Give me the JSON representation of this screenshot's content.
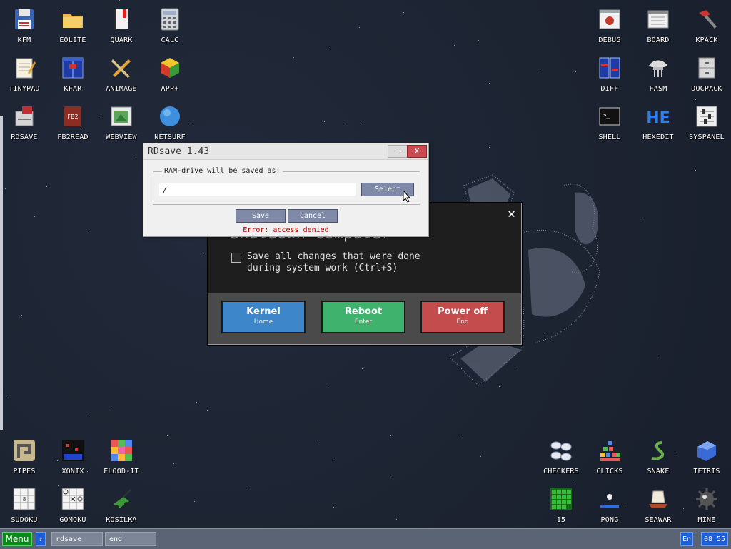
{
  "desktop_icons": {
    "kfm": "KFM",
    "eolite": "EOLITE",
    "quark": "QUARK",
    "calc": "CALC",
    "tinypad": "TINYPAD",
    "kfar": "KFAR",
    "animage": "ANIMAGE",
    "app_plus": "APP+",
    "rdsave": "RDSAVE",
    "fb2read": "FB2READ",
    "webview": "WEBVIEW",
    "netsurf": "NETSURF",
    "debug": "DEBUG",
    "board": "BOARD",
    "kpack": "KPACK",
    "diff": "DIFF",
    "fasm": "FASM",
    "docpack": "DOCPACK",
    "shell": "SHELL",
    "hexedit": "HEXEDIT",
    "syspanel": "SYSPANEL",
    "pipes": "PIPES",
    "xonix": "XONIX",
    "flood_it": "FLOOD-IT",
    "sudoku": "SUDOKU",
    "gomoku": "GOMOKU",
    "kosilka": "KOSILKA",
    "checkers": "CHECKERS",
    "clicks": "CLICKS",
    "snake": "SNAKE",
    "tetris": "TETRIS",
    "fifteen": "15",
    "pong": "PONG",
    "seawar": "SEAWAR",
    "mine": "MINE"
  },
  "shutdown_dialog": {
    "title": "Shutdown computer",
    "close_glyph": "✕",
    "checkbox_label_line1": "Save all changes that were done",
    "checkbox_label_line2": "during system work (Ctrl+S)",
    "kernel_label": "Kernel",
    "kernel_key": "Home",
    "reboot_label": "Reboot",
    "reboot_key": "Enter",
    "poweroff_label": "Power off",
    "poweroff_key": "End",
    "colors": {
      "kernel": "#3d86c9",
      "reboot": "#3fb36d",
      "poweroff": "#c44c4c"
    }
  },
  "rdsave_window": {
    "title": "RDsave 1.43",
    "minimize_glyph": "–",
    "close_glyph": "x",
    "group_label": "RAM-drive will be saved as:",
    "path_value": "/",
    "select_label": "Select",
    "save_label": "Save",
    "cancel_label": "Cancel",
    "error_text": "Error: access denied"
  },
  "taskbar": {
    "menu_label": "Menu",
    "switch_glyph": "↕",
    "tasks": [
      "rdsave",
      "end"
    ],
    "language": "En",
    "clock": "08 55"
  }
}
